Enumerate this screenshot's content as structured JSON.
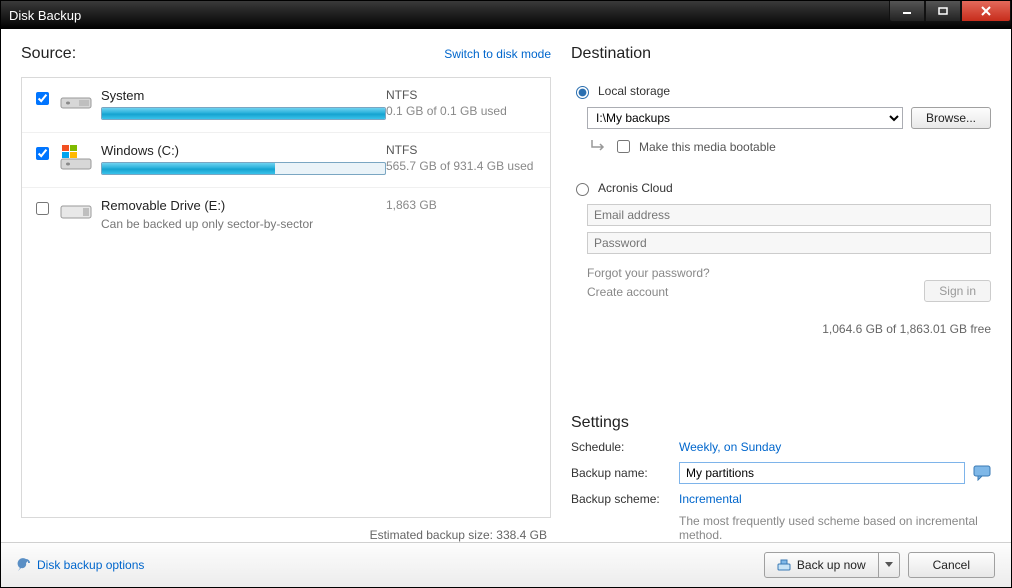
{
  "window": {
    "title": "Disk Backup"
  },
  "source": {
    "heading": "Source:",
    "switch_link": "Switch to disk mode",
    "drives": [
      {
        "name": "System",
        "fs": "NTFS",
        "usage_text": "0.1 GB of 0.1 GB used",
        "usage_pct": 100,
        "checked": true,
        "subtext": "",
        "icon": "hdd"
      },
      {
        "name": "Windows (C:)",
        "fs": "NTFS",
        "usage_text": "565.7 GB of 931.4 GB used",
        "usage_pct": 61,
        "checked": true,
        "subtext": "",
        "icon": "win"
      },
      {
        "name": "Removable Drive (E:)",
        "fs": "",
        "usage_text": "1,863 GB",
        "usage_pct": 0,
        "checked": false,
        "subtext": "Can be backed up only sector-by-sector",
        "icon": "removable"
      }
    ],
    "estimate_label": "Estimated backup size: 338.4 GB"
  },
  "destination": {
    "heading": "Destination",
    "local_label": "Local storage",
    "path_value": "I:\\My backups",
    "browse_label": "Browse...",
    "bootable_label": "Make this media bootable",
    "cloud_label": "Acronis Cloud",
    "email_placeholder": "Email address",
    "password_placeholder": "Password",
    "forgot_link": "Forgot your password?",
    "create_link": "Create account",
    "signin_label": "Sign in",
    "free_space": "1,064.6 GB of 1,863.01 GB free"
  },
  "settings": {
    "heading": "Settings",
    "schedule_label": "Schedule:",
    "schedule_value": "Weekly, on Sunday",
    "name_label": "Backup name:",
    "name_value": "My partitions",
    "scheme_label": "Backup scheme:",
    "scheme_value": "Incremental",
    "scheme_desc": "The most frequently used scheme based on incremental method."
  },
  "footer": {
    "options_link": "Disk backup options",
    "backup_now": "Back up now",
    "cancel": "Cancel"
  }
}
